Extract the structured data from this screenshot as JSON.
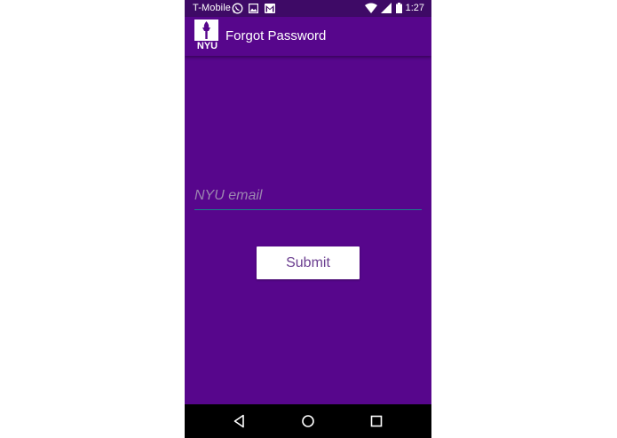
{
  "status_bar": {
    "carrier": "T-Mobile",
    "time": "1:27",
    "icons": [
      "whatsapp-icon",
      "image-icon",
      "gmail-icon",
      "wifi-icon",
      "signal-icon",
      "battery-icon"
    ]
  },
  "app_bar": {
    "logo_text": "NYU",
    "title": "Forgot Password"
  },
  "form": {
    "email_placeholder": "NYU email",
    "email_value": "",
    "submit_label": "Submit"
  },
  "nav_bar": {
    "icons": [
      "back-icon",
      "home-icon",
      "recents-icon"
    ]
  },
  "colors": {
    "background": "#57068c",
    "status_bar": "#3e0a66",
    "underline": "#19808a",
    "button_text": "#6a3d8f",
    "nav_bar": "#000000"
  }
}
